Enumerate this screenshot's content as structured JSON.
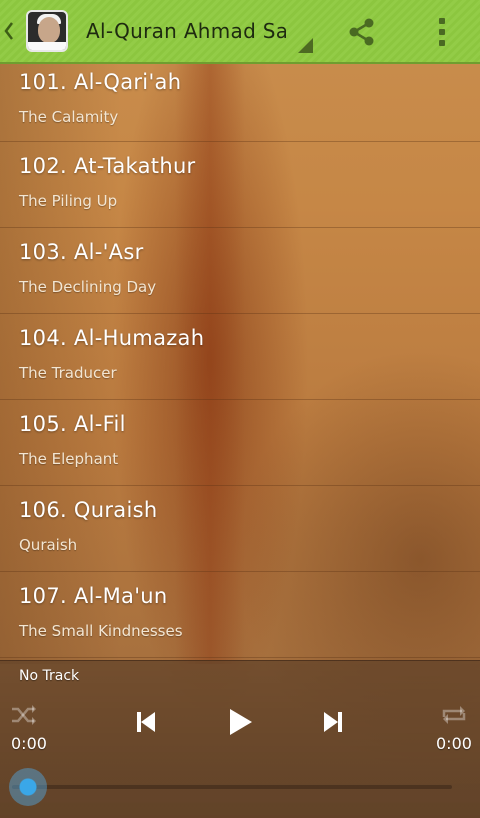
{
  "app_bar": {
    "title": "Al-Quran Ahmad Sa.."
  },
  "tracks": [
    {
      "title": "101. Al-Qari'ah",
      "subtitle": "The Calamity"
    },
    {
      "title": "102. At-Takathur",
      "subtitle": "The Piling Up"
    },
    {
      "title": "103. Al-'Asr",
      "subtitle": "The Declining Day"
    },
    {
      "title": "104. Al-Humazah",
      "subtitle": "The Traducer"
    },
    {
      "title": "105. Al-Fil",
      "subtitle": "The Elephant"
    },
    {
      "title": "106. Quraish",
      "subtitle": "Quraish"
    },
    {
      "title": "107. Al-Ma'un",
      "subtitle": "The Small Kindnesses"
    }
  ],
  "player": {
    "now_playing": "No Track",
    "elapsed": "0:00",
    "duration": "0:00",
    "progress": 0
  },
  "colors": {
    "action_bar": "#8cc63f",
    "seek_thumb": "#3aa7e8"
  },
  "icons": [
    "back-chevron-icon",
    "app-icon",
    "share-icon",
    "overflow-menu-icon",
    "shuffle-icon",
    "previous-icon",
    "play-icon",
    "next-icon",
    "repeat-icon"
  ]
}
